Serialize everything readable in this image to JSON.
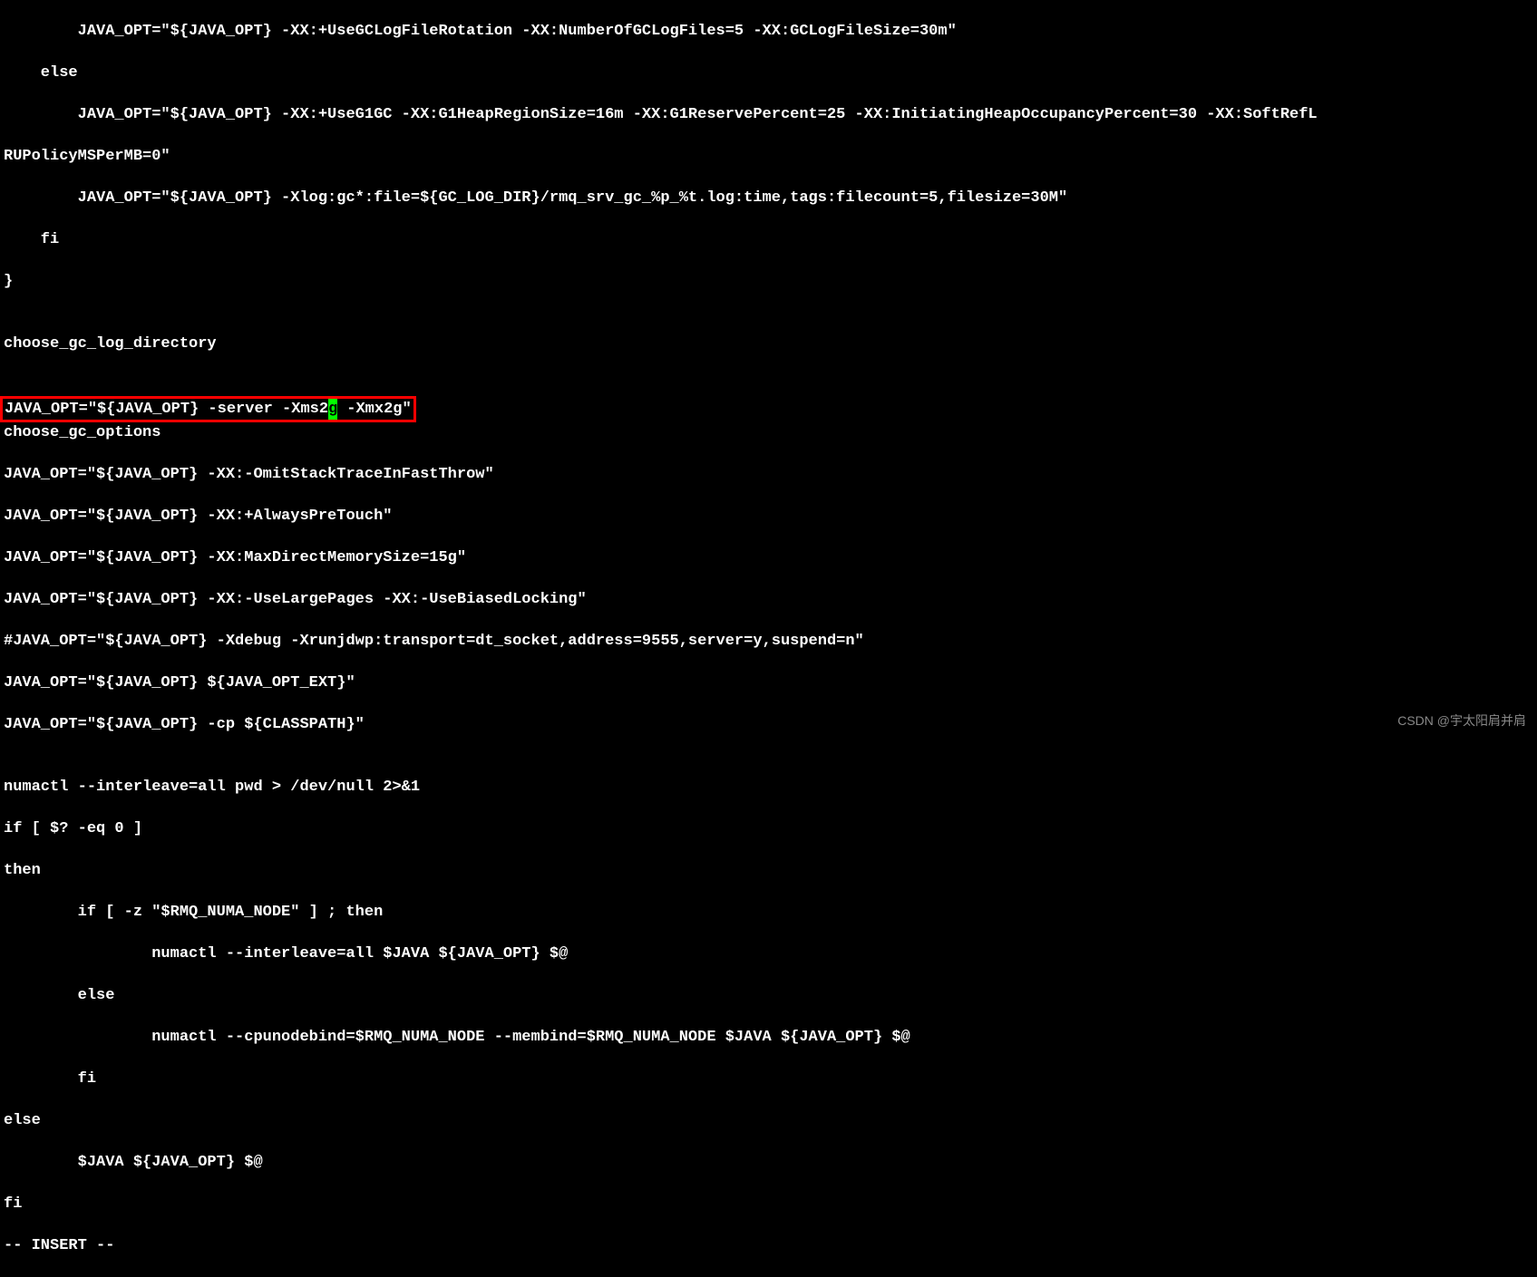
{
  "lines": {
    "l1": "        JAVA_OPT=\"${JAVA_OPT} -XX:+UseGCLogFileRotation -XX:NumberOfGCLogFiles=5 -XX:GCLogFileSize=30m\"",
    "l2": "    else",
    "l3": "        JAVA_OPT=\"${JAVA_OPT} -XX:+UseG1GC -XX:G1HeapRegionSize=16m -XX:G1ReservePercent=25 -XX:InitiatingHeapOccupancyPercent=30 -XX:SoftRefL",
    "l4": "RUPolicyMSPerMB=0\"",
    "l5": "        JAVA_OPT=\"${JAVA_OPT} -Xlog:gc*:file=${GC_LOG_DIR}/rmq_srv_gc_%p_%t.log:time,tags:filecount=5,filesize=30M\"",
    "l6": "    fi",
    "l7": "}",
    "l8": "",
    "l9": "choose_gc_log_directory",
    "l10": "",
    "l11_pre": "JAVA_OPT=\"${JAVA_OPT} -server -Xms2",
    "l11_cursor": "g",
    "l11_post": " -Xmx2g\"",
    "l12": "choose_gc_options",
    "l13": "JAVA_OPT=\"${JAVA_OPT} -XX:-OmitStackTraceInFastThrow\"",
    "l14": "JAVA_OPT=\"${JAVA_OPT} -XX:+AlwaysPreTouch\"",
    "l15": "JAVA_OPT=\"${JAVA_OPT} -XX:MaxDirectMemorySize=15g\"",
    "l16": "JAVA_OPT=\"${JAVA_OPT} -XX:-UseLargePages -XX:-UseBiasedLocking\"",
    "l17": "#JAVA_OPT=\"${JAVA_OPT} -Xdebug -Xrunjdwp:transport=dt_socket,address=9555,server=y,suspend=n\"",
    "l18": "JAVA_OPT=\"${JAVA_OPT} ${JAVA_OPT_EXT}\"",
    "l19": "JAVA_OPT=\"${JAVA_OPT} -cp ${CLASSPATH}\"",
    "l20": "",
    "l21": "numactl --interleave=all pwd > /dev/null 2>&1",
    "l22": "if [ $? -eq 0 ]",
    "l23": "then",
    "l24": "        if [ -z \"$RMQ_NUMA_NODE\" ] ; then",
    "l25": "                numactl --interleave=all $JAVA ${JAVA_OPT} $@",
    "l26": "        else",
    "l27": "                numactl --cpunodebind=$RMQ_NUMA_NODE --membind=$RMQ_NUMA_NODE $JAVA ${JAVA_OPT} $@",
    "l28": "        fi",
    "l29": "else",
    "l30": "        $JAVA ${JAVA_OPT} $@",
    "l31": "fi",
    "l32": "-- INSERT --"
  },
  "watermark": "CSDN @宇太阳肩并肩"
}
